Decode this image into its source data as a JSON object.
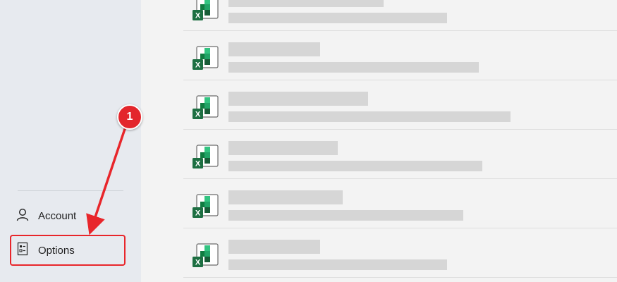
{
  "sidebar": {
    "items": [
      {
        "label": "Account",
        "icon": "person-icon"
      },
      {
        "label": "Options",
        "icon": "options-icon"
      }
    ]
  },
  "callout": {
    "number": "1",
    "color": "#e3262c"
  },
  "files": [
    {
      "icon": "excel-file-icon",
      "name": "",
      "path": ""
    },
    {
      "icon": "excel-file-icon",
      "name": "",
      "path": ""
    },
    {
      "icon": "excel-file-icon",
      "name": "",
      "path": ""
    },
    {
      "icon": "excel-file-icon",
      "name": "",
      "path": ""
    },
    {
      "icon": "excel-file-icon",
      "name": "",
      "path": ""
    },
    {
      "icon": "excel-file-icon",
      "name": "",
      "path": ""
    }
  ],
  "colors": {
    "accent": "#e8262b",
    "excel_green": "#1d6f42"
  }
}
